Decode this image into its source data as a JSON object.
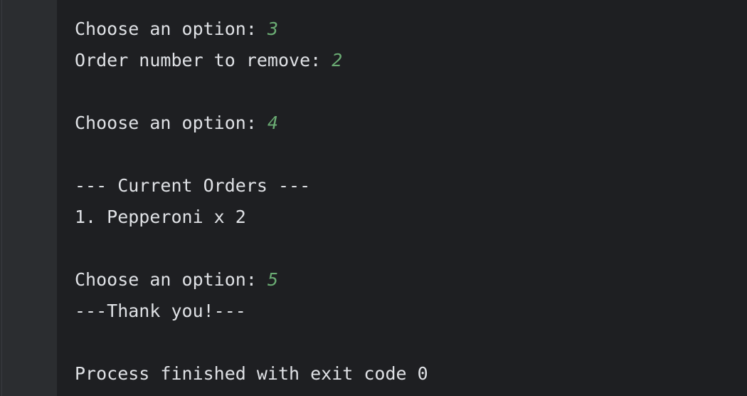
{
  "console": {
    "lines": [
      {
        "prompt": "Choose an option: ",
        "input": "3"
      },
      {
        "prompt": "Order number to remove: ",
        "input": "2"
      },
      {
        "prompt": "Choose an option: ",
        "input": "4"
      },
      {
        "text": "--- Current Orders ---"
      },
      {
        "text": "1. Pepperoni x 2"
      },
      {
        "prompt": "Choose an option: ",
        "input": "5"
      },
      {
        "text": "---Thank you!---"
      },
      {
        "text": "Process finished with exit code 0"
      }
    ]
  },
  "colors": {
    "background": "#1e1f22",
    "gutter": "#2b2d30",
    "output_text": "#dfe1e5",
    "user_input": "#6aab73"
  }
}
